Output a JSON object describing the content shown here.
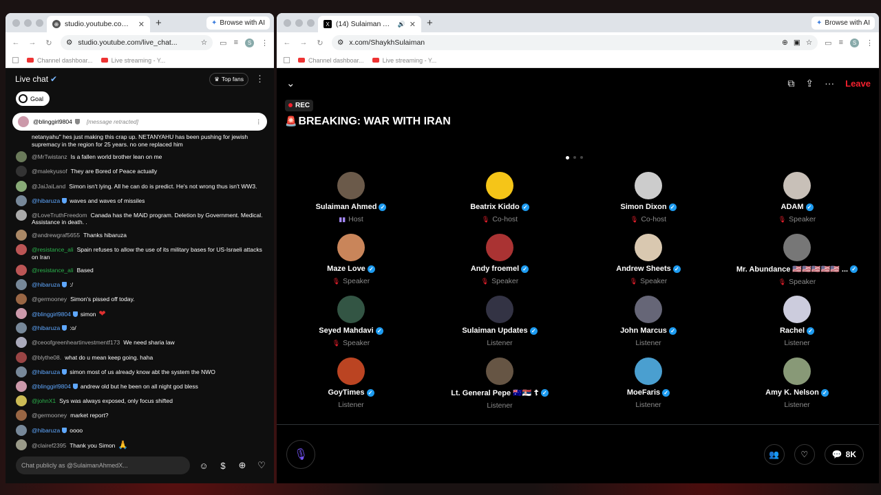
{
  "left": {
    "tab_title": "studio.youtube.com/live_chat",
    "new_tab": "+",
    "ai_button": "Browse with AI",
    "url": "studio.youtube.com/live_chat...",
    "profile": "S",
    "bookmarks": [
      "Channel dashboar...",
      "Live streaming - Y..."
    ],
    "chat": {
      "title": "Live chat",
      "top_fans": "Top fans",
      "goal": "Goal",
      "pinned_author": "@blinggirl9804",
      "pinned_text": "[message retracted]",
      "input_placeholder": "Chat publicly as @SulaimanAhmedX...",
      "messages": [
        {
          "author": "",
          "text": "netanyahu\" hes just making this crap up. NETANYAHU has been pushing for jewish supremacy in the region for 25 years. no one replaced him",
          "color": "#888"
        },
        {
          "author": "@MrTwistanz",
          "text": "Is a fallen world brother lean on me",
          "color": "#6a7a5a"
        },
        {
          "author": "@malekyusof",
          "text": "They are Bored of Peace actually",
          "color": "#333"
        },
        {
          "author": "@JaiJaiLand",
          "text": "Simon isn't lying. All he can do is predict. He's not wrong thus isn't WW3.",
          "color": "#8a7"
        },
        {
          "author": "@hibaruza",
          "text": "waves and waves of missiles",
          "color": "#789",
          "mod": true
        },
        {
          "author": "@LoveTruthFreedom",
          "text": "Canada has the MAiD program. Deletion by Government. Medical. Assistance in death. .",
          "color": "#aaa"
        },
        {
          "author": "@andrewgraf5655",
          "text": "Thanks hibaruza",
          "color": "#a86"
        },
        {
          "author": "@resistance_ali",
          "text": "Spain refuses to allow the use of its military bases for US-Israeli attacks on Iran",
          "color": "#b55",
          "green": true
        },
        {
          "author": "@resistance_ali",
          "text": "Based",
          "color": "#b55",
          "green": true
        },
        {
          "author": "@hibaruza",
          "text": ":/",
          "color": "#789",
          "mod": true
        },
        {
          "author": "@germooney",
          "text": "Simon's pissed off today.",
          "color": "#964"
        },
        {
          "author": "@blinggirl9804",
          "text": "simon",
          "color": "#c9a",
          "mod": true,
          "heart": "❤"
        },
        {
          "author": "@hibaruza",
          "text": ":o/",
          "color": "#789",
          "mod": true
        },
        {
          "author": "@ceoofgreenheartinvestmentf173",
          "text": "We need sharia law",
          "color": "#aab"
        },
        {
          "author": "@blythe08.",
          "text": "what do u mean keep going. haha",
          "color": "#944"
        },
        {
          "author": "@hibaruza",
          "text": "simon most of us already know abt the system the NWO",
          "color": "#789",
          "mod": true
        },
        {
          "author": "@blinggirl9804",
          "text": "andrew old but he been on all night god bless",
          "color": "#c9a",
          "mod": true
        },
        {
          "author": "@johnX1",
          "text": "Sys was always exposed, only focus shifted",
          "color": "#cb5",
          "green": true
        },
        {
          "author": "@germooney",
          "text": "market report?",
          "color": "#964"
        },
        {
          "author": "@hibaruza",
          "text": "oooo",
          "color": "#789",
          "mod": true
        },
        {
          "author": "@clairef2395",
          "text": "Thank you Simon",
          "color": "#998",
          "heart": "🙏"
        }
      ]
    }
  },
  "right": {
    "tab_title": "(14) Sulaiman Ahmed (@Sh...",
    "new_tab": "+",
    "ai_button": "Browse with AI",
    "url": "x.com/ShaykhSulaiman",
    "profile": "S",
    "bookmarks": [
      "Channel dashboar...",
      "Live streaming - Y..."
    ],
    "space": {
      "leave": "Leave",
      "rec": "REC",
      "title": "BREAKING: WAR WITH IRAN",
      "count": "8K",
      "participants": [
        {
          "name": "Sulaiman Ahmed",
          "role": "Host",
          "color": "#6b5a4a"
        },
        {
          "name": "Beatrix Kiddo",
          "role": "Co-host",
          "color": "#f5c518"
        },
        {
          "name": "Simon Dixon",
          "role": "Co-host",
          "color": "#ccc"
        },
        {
          "name": "ADAM",
          "role": "Speaker",
          "color": "#c8c0b8"
        },
        {
          "name": "Maze Love",
          "role": "Speaker",
          "color": "#c9855a"
        },
        {
          "name": "Andy froemel",
          "role": "Speaker",
          "color": "#a33"
        },
        {
          "name": "Andrew Sheets",
          "role": "Speaker",
          "color": "#d9c8b0"
        },
        {
          "name": "Mr. Abundance 🇺🇸🇺🇸🇺🇸🇺🇸🇺🇸 ...",
          "role": "Speaker",
          "color": "#777"
        },
        {
          "name": "Seyed Mahdavi",
          "role": "Speaker",
          "color": "#354"
        },
        {
          "name": "Sulaiman Updates",
          "role": "Listener",
          "color": "#334"
        },
        {
          "name": "John Marcus",
          "role": "Listener",
          "color": "#667"
        },
        {
          "name": "Rachel",
          "role": "Listener",
          "color": "#ccd"
        },
        {
          "name": "GoyTimes",
          "role": "Listener",
          "color": "#b42"
        },
        {
          "name": "Lt. General Pepe 🇦🇺🇷🇸 ☦",
          "role": "Listener",
          "color": "#654"
        },
        {
          "name": "MoeFaris",
          "role": "Listener",
          "color": "#4a9fd0"
        },
        {
          "name": "Amy K. Nelson",
          "role": "Listener",
          "color": "#897"
        }
      ]
    }
  }
}
